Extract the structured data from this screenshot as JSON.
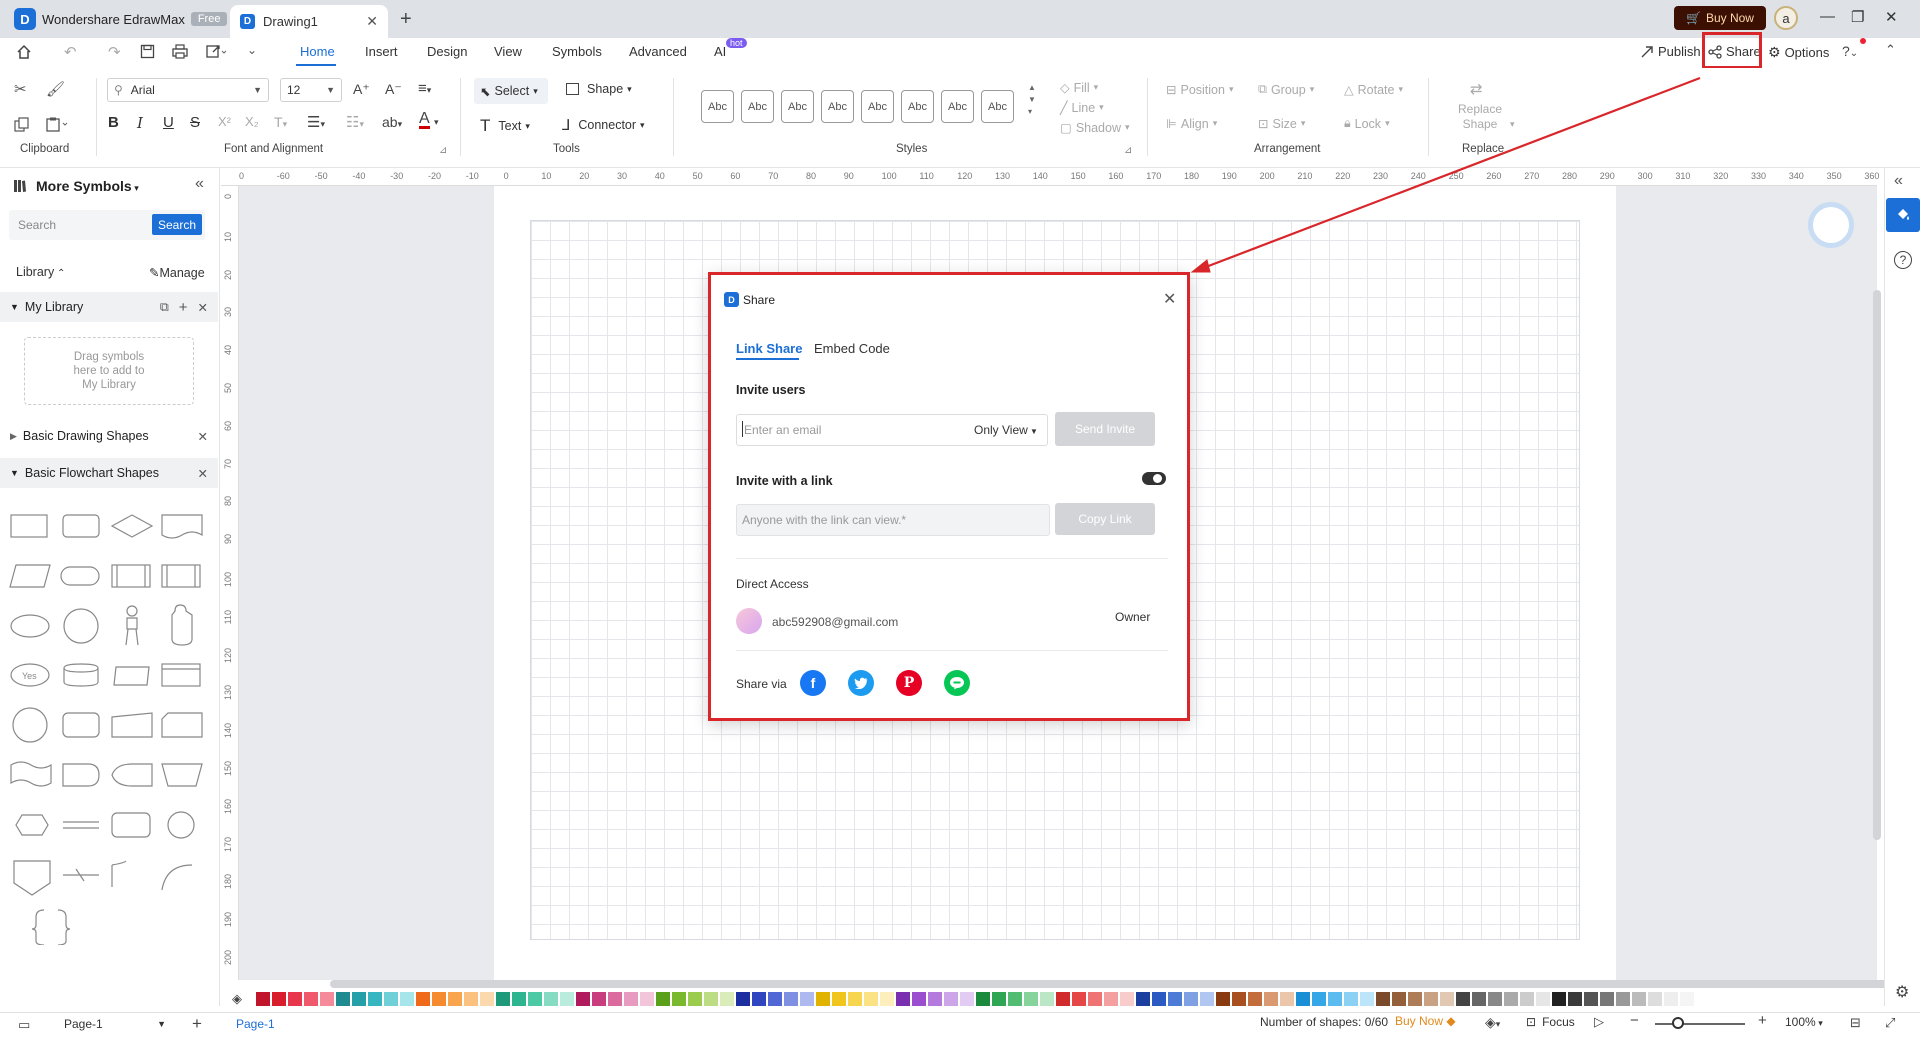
{
  "titlebar": {
    "app_name": "Wondershare EdrawMax",
    "free_badge": "Free",
    "doc_tab": "Drawing1",
    "buy_now": "Buy Now",
    "avatar_letter": "a"
  },
  "menu": {
    "items": [
      "Home",
      "Insert",
      "Design",
      "View",
      "Symbols",
      "Advanced",
      "AI"
    ],
    "active": "Home",
    "ai_badge": "hot",
    "publish": "Publish",
    "share": "Share",
    "options": "Options"
  },
  "ribbon": {
    "font_name": "Arial",
    "font_size": "12",
    "select": "Select",
    "shape": "Shape",
    "text": "Text",
    "connector": "Connector",
    "style_label": "Abc",
    "fill": "Fill",
    "line": "Line",
    "shadow": "Shadow",
    "position": "Position",
    "group": "Group",
    "rotate": "Rotate",
    "align": "Align",
    "size": "Size",
    "lock": "Lock",
    "replace_shape_1": "Replace",
    "replace_shape_2": "Shape",
    "groups": {
      "clipboard": "Clipboard",
      "font": "Font and Alignment",
      "tools": "Tools",
      "styles": "Styles",
      "arrangement": "Arrangement",
      "replace": "Replace"
    }
  },
  "left_panel": {
    "title": "More Symbols",
    "search_placeholder": "Search",
    "search_button": "Search",
    "library": "Library",
    "manage": "Manage",
    "my_library": "My Library",
    "drop_hint_1": "Drag symbols",
    "drop_hint_2": "here to add to",
    "drop_hint_3": "My Library",
    "basic_drawing": "Basic Drawing Shapes",
    "basic_flowchart": "Basic Flowchart Shapes",
    "yes_shape": "Yes"
  },
  "rulers": {
    "h_ticks": [
      "0",
      "-60",
      "-50",
      "-40",
      "-30",
      "-20",
      "-10",
      "0",
      "10",
      "20",
      "30",
      "40",
      "50",
      "60",
      "70",
      "80",
      "90",
      "100",
      "110",
      "120",
      "130",
      "140",
      "150",
      "160",
      "170",
      "180",
      "190",
      "200",
      "210",
      "220",
      "230",
      "240",
      "250",
      "260",
      "270",
      "280",
      "290",
      "300",
      "310",
      "320",
      "330",
      "340",
      "350",
      "360"
    ],
    "v_ticks": [
      "0",
      "10",
      "20",
      "30",
      "40",
      "50",
      "60",
      "70",
      "80",
      "90",
      "100",
      "110",
      "120",
      "130",
      "140",
      "150",
      "160",
      "170",
      "180",
      "190",
      "200"
    ]
  },
  "dialog": {
    "title": "Share",
    "tab_link": "Link Share",
    "tab_embed": "Embed Code",
    "invite_users": "Invite users",
    "email_placeholder": "Enter an email",
    "permission": "Only View",
    "send_invite": "Send Invite",
    "invite_link": "Invite with a link",
    "link_placeholder": "Anyone with the link can view.*",
    "copy_link": "Copy Link",
    "direct_access": "Direct Access",
    "user_email": "abc592908@gmail.com",
    "user_role": "Owner",
    "share_via": "Share via",
    "socials": [
      "facebook",
      "twitter",
      "pinterest",
      "line"
    ]
  },
  "statusbar": {
    "page_select": "Page-1",
    "page_tab": "Page-1",
    "shapes_count": "Number of shapes: 0/60",
    "buy_now": "Buy Now",
    "focus": "Focus",
    "zoom": "100%"
  },
  "colors": {
    "accent": "#1b6fd6",
    "highlight": "#d9262b",
    "palette": [
      "#c0152b",
      "#d81d2c",
      "#e8364d",
      "#f0586b",
      "#f58a9a",
      "#1f8a8f",
      "#25a0a8",
      "#36b6c0",
      "#6fd0d8",
      "#a6e6ea",
      "#f06a1b",
      "#f58a2e",
      "#f9a54d",
      "#fbc17e",
      "#fcd9ad",
      "#1e9a7a",
      "#2cb58f",
      "#4cc9a5",
      "#86dcc2",
      "#b9ecdc",
      "#b01b5e",
      "#c93c7e",
      "#db6b9f",
      "#e89bc0",
      "#f2c5db",
      "#5aa01b",
      "#7ab92e",
      "#9ccc4e",
      "#bddd85",
      "#d9ecb9",
      "#1d2fa0",
      "#2f46c0",
      "#5267d6",
      "#7f90e3",
      "#aeb9ef",
      "#e0b300",
      "#f0c51c",
      "#f7d54e",
      "#fae285",
      "#fcefbb",
      "#7a2fb0",
      "#9b4fcf",
      "#b57ade",
      "#cda6ea",
      "#e3ccf4",
      "#1b8a3c",
      "#2ea653",
      "#52bd72",
      "#86d39c",
      "#bbe7c6",
      "#d02a2a",
      "#e54747",
      "#ef7373",
      "#f5a0a0",
      "#f9cccc",
      "#1a3f9e",
      "#2b5bc2",
      "#4d7bd6",
      "#7fa1e4",
      "#b1c6f0",
      "#8a3a10",
      "#a85020",
      "#c46d3c",
      "#d99a72",
      "#ebc6ab",
      "#1a8fd6",
      "#35a7e6",
      "#5cbcef",
      "#8ad1f4",
      "#bde5f9",
      "#7a4a2a",
      "#94603a",
      "#ae7d57",
      "#c8a283",
      "#e0c8b3",
      "#444444",
      "#666666",
      "#888888",
      "#aaaaaa",
      "#cccccc",
      "#e6e6e6",
      "#222222",
      "#3a3a3a",
      "#555555",
      "#777777",
      "#999999",
      "#bbbbbb",
      "#dddddd",
      "#eeeeee",
      "#f5f5f5"
    ]
  },
  "icons": [
    "home-icon",
    "undo-icon",
    "redo-icon",
    "save-icon",
    "print-icon",
    "export-icon",
    "more-icon",
    "publish-icon",
    "share-icon",
    "options-icon",
    "help-icon",
    "collapse-icon",
    "search-icon",
    "close-icon",
    "plus-icon",
    "chevron-down-icon",
    "facebook-icon",
    "twitter-icon",
    "pinterest-icon",
    "line-icon"
  ]
}
